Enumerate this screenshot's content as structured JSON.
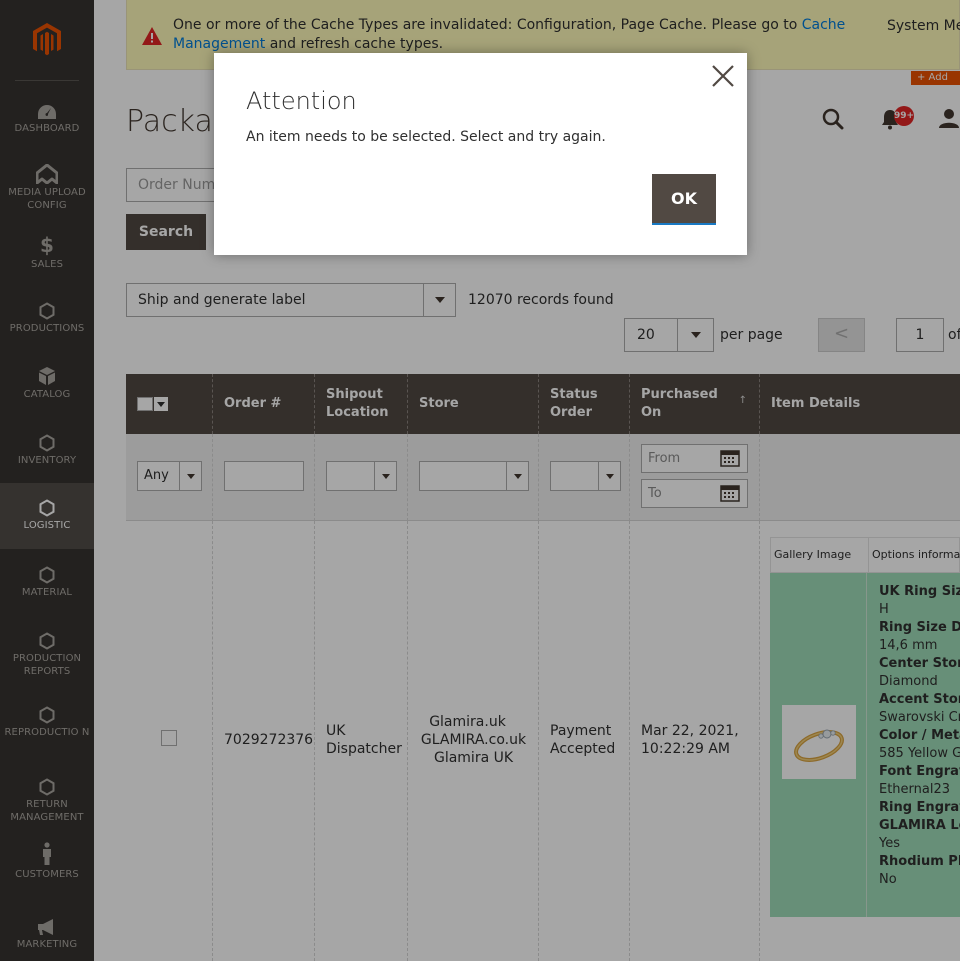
{
  "sidebar": {
    "logo": "magento-logo",
    "items": [
      {
        "label": "DASHBOARD",
        "icon": "dashboard-icon"
      },
      {
        "label": "MEDIA UPLOAD CONFIG",
        "icon": "media-upload-icon"
      },
      {
        "label": "SALES",
        "icon": "dollar-icon"
      },
      {
        "label": "PRODUCTIONS",
        "icon": "hexagon-icon"
      },
      {
        "label": "CATALOG",
        "icon": "cube-icon"
      },
      {
        "label": "INVENTORY",
        "icon": "hexagon-icon"
      },
      {
        "label": "LOGISTIC",
        "icon": "hexagon-icon",
        "active": true
      },
      {
        "label": "MATERIAL",
        "icon": "hexagon-icon"
      },
      {
        "label": "PRODUCTION REPORTS",
        "icon": "hexagon-icon"
      },
      {
        "label": "REPRODUCTIO N",
        "icon": "hexagon-icon"
      },
      {
        "label": "RETURN MANAGEMENT",
        "icon": "hexagon-icon"
      },
      {
        "label": "CUSTOMERS",
        "icon": "person-icon"
      },
      {
        "label": "MARKETING",
        "icon": "megaphone-icon"
      }
    ]
  },
  "system_message": {
    "text_before": "One or more of the Cache Types are invalidated: Configuration, Page Cache. Please go to",
    "link": "Cache Management",
    "text_after": "and refresh cache types.",
    "system_messages_label": "System Me",
    "add_badge": "+ Add"
  },
  "header": {
    "title": "Packag",
    "notifications_count": "99+"
  },
  "search": {
    "placeholder": "Order Num",
    "button": "Search"
  },
  "toolbar": {
    "mass_action": "Ship and generate label",
    "records": "12070 records found",
    "per_page_value": "20",
    "per_page_label": "per page",
    "prev": "<",
    "page": "1",
    "of": "of"
  },
  "grid": {
    "columns": [
      "Order #",
      "Shipout Location",
      "Store",
      "Status Order",
      "Purchased On",
      "Item Details"
    ],
    "sort_indicator": "↑",
    "filters": {
      "any": "Any",
      "from": "From",
      "to": "To"
    },
    "row": {
      "order": "7029272376",
      "location": "UK Dispatcher",
      "store_lines": [
        "Glamira.uk",
        "GLAMIRA.co.uk",
        "Glamira UK"
      ],
      "status": "Payment Accepted",
      "purchased": "Mar 22, 2021, 10:22:29 AM",
      "items_header": [
        "Gallery Image",
        "Options informa"
      ],
      "options": [
        {
          "k": "UK Ring Size",
          "v": "H"
        },
        {
          "k": "Ring Size Di",
          "v": "14,6 mm"
        },
        {
          "k": "Center Ston",
          "v": "Diamond"
        },
        {
          "k": "Accent Ston",
          "v": "Swarovski Cr"
        },
        {
          "k": "Color / Meta",
          "v": "585 Yellow G"
        },
        {
          "k": "Font Engrav",
          "v": "Ethernal23"
        },
        {
          "k": "Ring Engrav",
          "v": null
        },
        {
          "k": "GLAMIRA Lo",
          "v": "Yes"
        },
        {
          "k": "Rhodium Pl",
          "v": "No"
        }
      ]
    }
  },
  "modal": {
    "title": "Attention",
    "text": "An item needs to be selected. Select and try again.",
    "ok": "OK"
  },
  "colors": {
    "sidebar": "#373330",
    "header_dark": "#514943",
    "notice_bg": "#fffbbb",
    "row_highlight": "#9fdcb8",
    "badge": "#e22626",
    "accent": "#eb5202"
  }
}
